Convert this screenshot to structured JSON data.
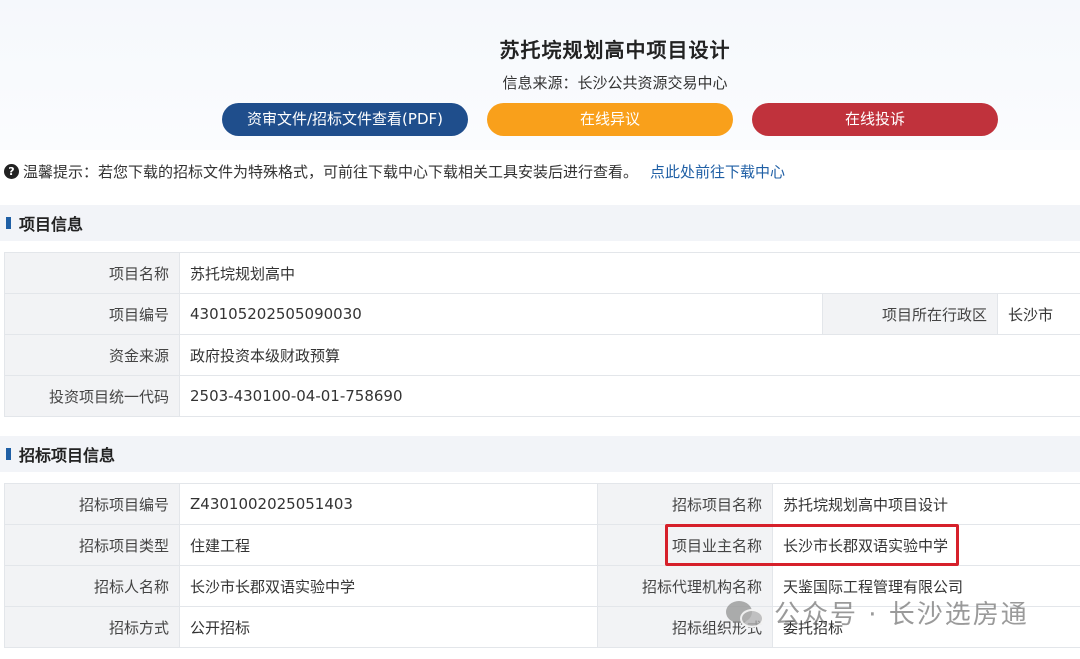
{
  "header": {
    "title": "苏托垸规划高中项目设计",
    "source": "信息来源：长沙公共资源交易中心"
  },
  "buttons": {
    "view_files": "资审文件/招标文件查看(PDF)",
    "objection": "在线异议",
    "complaint": "在线投诉"
  },
  "notice": {
    "icon": "question-circle-icon",
    "text": "温馨提示：若您下载的招标文件为特殊格式，可前往下载中心下载相关工具安装后进行查看。",
    "link": "点此处前往下载中心"
  },
  "project_info": {
    "section_title": "项目信息",
    "name_label": "项目名称",
    "name_value": "苏托垸规划高中",
    "code_label": "项目编号",
    "code_value": "430105202505090030",
    "region_label": "项目所在行政区",
    "region_value": "长沙市",
    "fund_label": "资金来源",
    "fund_value": "政府投资本级财政预算",
    "invest_label": "投资项目统一代码",
    "invest_value": "2503-430100-04-01-758690"
  },
  "bid_info": {
    "section_title": "招标项目信息",
    "rows": [
      {
        "l1": "招标项目编号",
        "v1": "Z4301002025051403",
        "l2": "招标项目名称",
        "v2": "苏托垸规划高中项目设计"
      },
      {
        "l1": "招标项目类型",
        "v1": "住建工程",
        "l2": "项目业主名称",
        "v2": "长沙市长郡双语实验中学"
      },
      {
        "l1": "招标人名称",
        "v1": "长沙市长郡双语实验中学",
        "l2": "招标代理机构名称",
        "v2": "天鉴国际工程管理有限公司"
      },
      {
        "l1": "招标方式",
        "v1": "公开招标",
        "l2": "招标组织形式",
        "v2": "委托招标"
      }
    ]
  },
  "watermark": {
    "icon": "wechat-icon",
    "text": "公众号 · 长沙选房通"
  },
  "colors": {
    "primary": "#1f4e8c",
    "orange": "#f9a01b",
    "red": "#c0323c",
    "highlight": "#d6202a"
  }
}
